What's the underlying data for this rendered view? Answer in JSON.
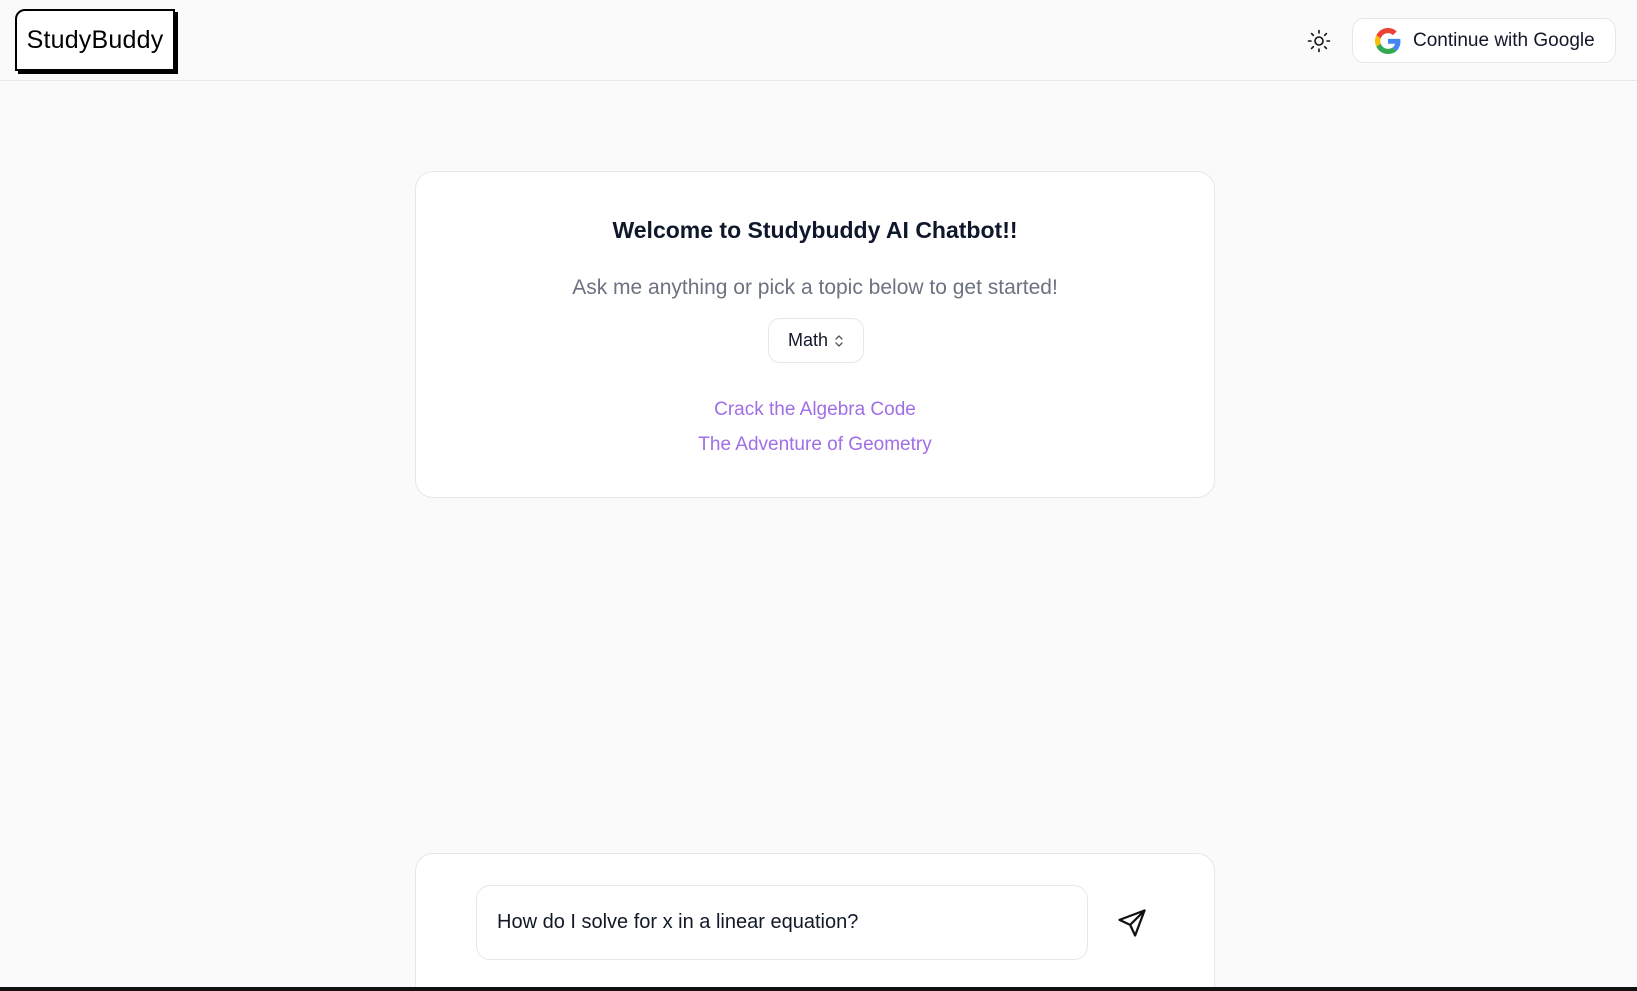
{
  "header": {
    "logo_text": "StudyBuddy",
    "theme_toggle_icon": "sun-icon",
    "google_button_label": "Continue with Google",
    "google_icon": "google-g-icon"
  },
  "welcome": {
    "title": "Welcome to Studybuddy AI Chatbot!!",
    "subtitle": "Ask me anything or pick a topic below to get started!",
    "topic_select": {
      "selected": "Math",
      "icon": "chevron-up-down-icon"
    },
    "topic_links": [
      "Crack the Algebra Code",
      "The Adventure of Geometry"
    ],
    "link_color": "#a06ee6"
  },
  "composer": {
    "input_value": "How do I solve for x in a linear equation?",
    "send_icon": "send-icon"
  }
}
